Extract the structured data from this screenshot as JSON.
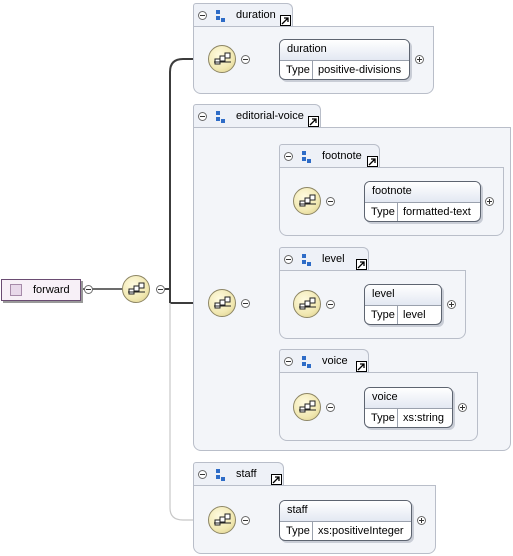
{
  "root": {
    "name": "forward"
  },
  "groups": {
    "duration": {
      "title": "duration",
      "element": {
        "name": "duration",
        "type_label": "Type",
        "type": "positive-divisions"
      }
    },
    "editorial_voice": {
      "title": "editorial-voice"
    },
    "footnote": {
      "title": "footnote",
      "element": {
        "name": "footnote",
        "type_label": "Type",
        "type": "formatted-text"
      }
    },
    "level": {
      "title": "level",
      "element": {
        "name": "level",
        "type_label": "Type",
        "type": "level"
      }
    },
    "voice": {
      "title": "voice",
      "element": {
        "name": "voice",
        "type_label": "Type",
        "type": "xs:string"
      }
    },
    "staff": {
      "title": "staff",
      "element": {
        "name": "staff",
        "type_label": "Type",
        "type": "xs:positiveInteger"
      }
    }
  },
  "colors": {
    "connector_dark": "#3c3c3c",
    "connector_light": "#c7c7c7",
    "group_bg": "#f3f5f9",
    "group_border": "#b9bec9"
  }
}
